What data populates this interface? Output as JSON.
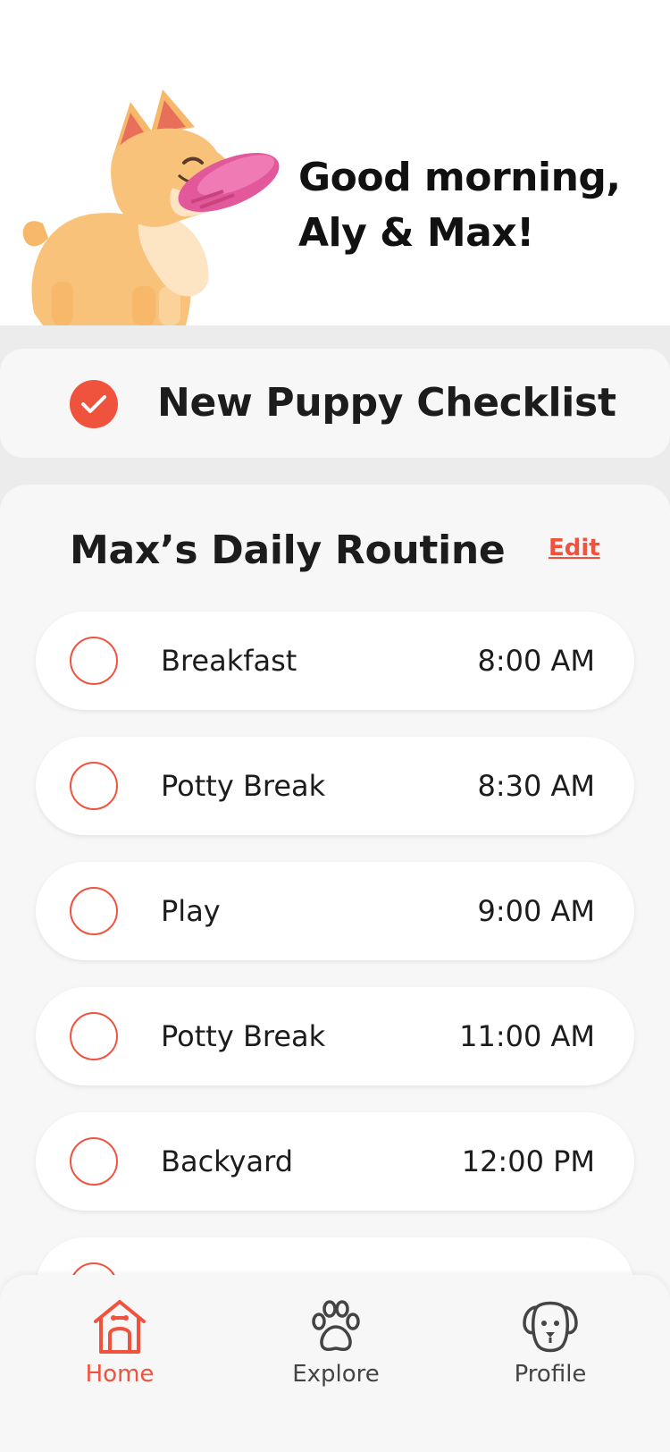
{
  "header": {
    "greeting_line1": "Good morning,",
    "greeting_line2": "Aly & Max!"
  },
  "checklist": {
    "title": "New Puppy Checklist"
  },
  "routine": {
    "title": "Max’s Daily Routine",
    "edit_label": "Edit",
    "tasks": [
      {
        "label": "Breakfast",
        "time": "8:00 AM"
      },
      {
        "label": "Potty Break",
        "time": "8:30 AM"
      },
      {
        "label": "Play",
        "time": "9:00 AM"
      },
      {
        "label": "Potty Break",
        "time": "11:00 AM"
      },
      {
        "label": "Backyard",
        "time": "12:00 PM"
      },
      {
        "label": "",
        "time": ""
      }
    ]
  },
  "nav": {
    "items": [
      {
        "label": "Home",
        "icon": "dog-house-icon",
        "active": true
      },
      {
        "label": "Explore",
        "icon": "paw-icon",
        "active": false
      },
      {
        "label": "Profile",
        "icon": "dog-face-icon",
        "active": false
      }
    ]
  },
  "colors": {
    "accent": "#f0533d",
    "background": "#ececec",
    "card": "#f7f7f7",
    "text": "#1c1c1c"
  }
}
